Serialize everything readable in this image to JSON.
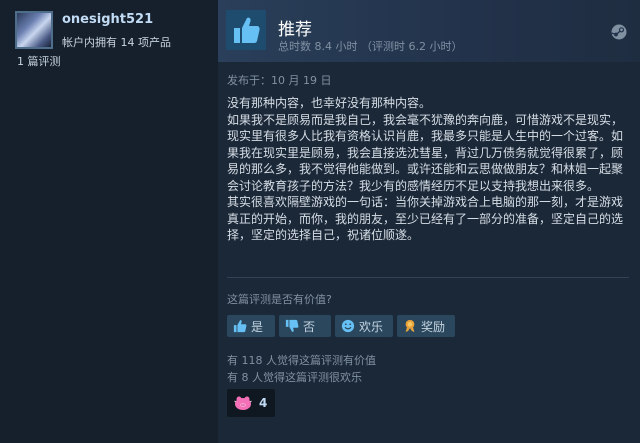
{
  "author": {
    "username": "onesight521",
    "products_owned": "帐户内拥有 14 项产品",
    "reviews_count": "1 篇评测"
  },
  "review": {
    "verdict": "推荐",
    "playtime": "总时数 8.4 小时 （评测时 6.2 小时）",
    "posted": "发布于：10 月 19 日",
    "paragraphs": [
      "没有那种内容，也幸好没有那种内容。",
      "如果我不是顾易而是我自己，我会毫不犹豫的奔向鹿，可惜游戏不是现实，现实里有很多人比我有资格认识肖鹿，我最多只能是人生中的一个过客。如果我在现实里是顾易，我会直接选沈彗星，背过几万债务就觉得很累了，顾易的那么多，我不觉得他能做到。或许还能和云思做做朋友？和林姐一起聚会讨论教育孩子的方法？我少有的感情经历不足以支持我想出来很多。",
      "其实很喜欢隔壁游戏的一句话：当你关掉游戏合上电脑的那一刻，才是游戏真正的开始，而你，我的朋友，至少已经有了一部分的准备，坚定自己的选择，坚定的选择自己，祝诸位顺遂。"
    ]
  },
  "feedback": {
    "question": "这篇评测是否有价值?",
    "yes_label": "是",
    "no_label": "否",
    "funny_label": "欢乐",
    "award_label": "奖励",
    "helpful_stat": "有 118 人觉得这篇评测有价值",
    "funny_stat": "有 8 人觉得这篇评测很欢乐",
    "award_count": "4"
  },
  "icons": {
    "verdict": "thumbs-up-icon",
    "platform": "steam-icon",
    "yes": "thumbs-up-icon",
    "no": "thumbs-down-icon",
    "funny": "smiley-icon",
    "award": "award-icon",
    "award_chip": "pig-award-icon"
  },
  "colors": {
    "background": "#1b2838",
    "accent_blue": "#66c0f4",
    "button": "#2a475e",
    "award_pink": "#f36fb6"
  }
}
